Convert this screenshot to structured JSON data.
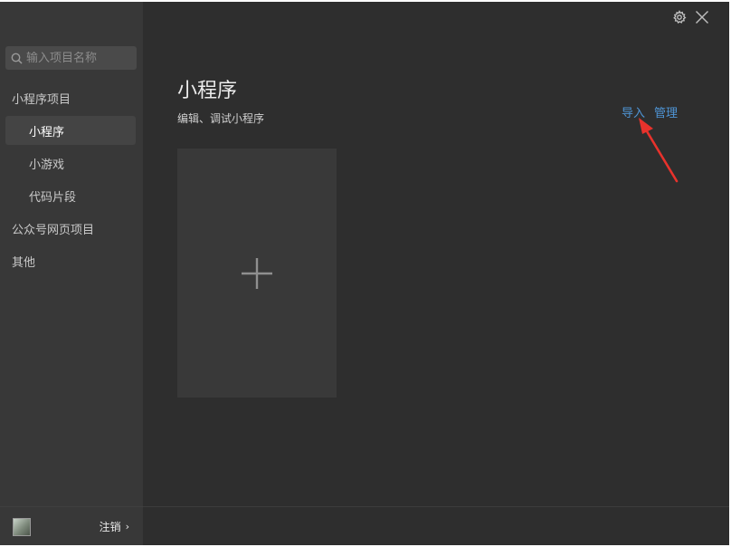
{
  "search": {
    "placeholder": "输入项目名称"
  },
  "sidebar": {
    "groups": [
      {
        "label": "小程序项目"
      },
      {
        "label": "公众号网页项目"
      },
      {
        "label": "其他"
      }
    ],
    "sub_items": [
      {
        "label": "小程序",
        "active": true
      },
      {
        "label": "小游戏"
      },
      {
        "label": "代码片段"
      }
    ],
    "footer": {
      "logout_label": "注销",
      "logout_chevron": "›"
    }
  },
  "main": {
    "title": "小程序",
    "subtitle": "编辑、调试小程序",
    "actions": {
      "import_label": "导入",
      "manage_label": "管理"
    }
  },
  "icons": {
    "search": "search-icon",
    "settings": "gear-icon",
    "close": "close-icon",
    "add": "plus-icon",
    "annotation": "red-arrow"
  },
  "colors": {
    "window_bg": "#2e2e2e",
    "sidebar_bg": "#383838",
    "active_item_bg": "#444444",
    "link": "#4f95d6",
    "arrow": "#e8322c",
    "card_bg": "#393939"
  }
}
